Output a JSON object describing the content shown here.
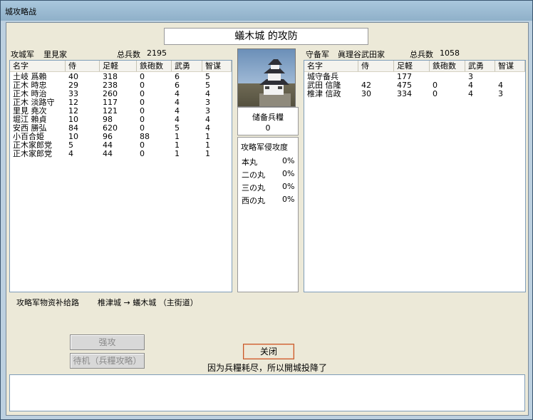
{
  "window": {
    "title": "城攻略战"
  },
  "header": {
    "title": "蟻木城 的攻防"
  },
  "attacker": {
    "label": "攻城军",
    "clan": "里見家",
    "total_label": "总兵数",
    "total": "2195",
    "columns": [
      "名字",
      "侍",
      "足軽",
      "鉄砲数",
      "武勇",
      "智谋"
    ],
    "rows": [
      {
        "name": "土岐 爲賴",
        "samurai": "40",
        "ashigaru": "318",
        "guns": "0",
        "valor": "6",
        "wit": "5"
      },
      {
        "name": "正木 時忠",
        "samurai": "29",
        "ashigaru": "238",
        "guns": "0",
        "valor": "6",
        "wit": "5"
      },
      {
        "name": "正木 時治",
        "samurai": "33",
        "ashigaru": "260",
        "guns": "0",
        "valor": "4",
        "wit": "4"
      },
      {
        "name": "正木 淡路守",
        "samurai": "12",
        "ashigaru": "117",
        "guns": "0",
        "valor": "4",
        "wit": "3"
      },
      {
        "name": "里見 堯次",
        "samurai": "12",
        "ashigaru": "121",
        "guns": "0",
        "valor": "4",
        "wit": "3"
      },
      {
        "name": "堀江 賴貞",
        "samurai": "10",
        "ashigaru": "98",
        "guns": "0",
        "valor": "4",
        "wit": "4"
      },
      {
        "name": "安西 勝弘",
        "samurai": "84",
        "ashigaru": "620",
        "guns": "0",
        "valor": "5",
        "wit": "4"
      },
      {
        "name": "小百合姫",
        "samurai": "10",
        "ashigaru": "96",
        "guns": "88",
        "valor": "1",
        "wit": "1"
      },
      {
        "name": "正木家郎党",
        "samurai": "5",
        "ashigaru": "44",
        "guns": "0",
        "valor": "1",
        "wit": "1"
      },
      {
        "name": "正木家郎党",
        "samurai": "4",
        "ashigaru": "44",
        "guns": "0",
        "valor": "1",
        "wit": "1"
      }
    ]
  },
  "defender": {
    "label": "守备军",
    "clan": "眞理谷武田家",
    "total_label": "总兵数",
    "total": "1058",
    "columns": [
      "名字",
      "侍",
      "足軽",
      "鉄砲数",
      "武勇",
      "智谋"
    ],
    "rows": [
      {
        "name": "城守备兵",
        "samurai": "",
        "ashigaru": "177",
        "guns": "",
        "valor": "3",
        "wit": ""
      },
      {
        "name": "武田 信隆",
        "samurai": "42",
        "ashigaru": "475",
        "guns": "0",
        "valor": "4",
        "wit": "4"
      },
      {
        "name": "椎津 信政",
        "samurai": "30",
        "ashigaru": "334",
        "guns": "0",
        "valor": "4",
        "wit": "3"
      }
    ]
  },
  "center": {
    "reserve_label": "储备兵糧",
    "reserve_value": "0",
    "invasion_label": "攻略军侵攻度",
    "invasion": [
      {
        "area": "本丸",
        "value": "0%"
      },
      {
        "area": "二の丸",
        "value": "0%"
      },
      {
        "area": "三の丸",
        "value": "0%"
      },
      {
        "area": "西の丸",
        "value": "0%"
      }
    ]
  },
  "supply": {
    "label": "攻略军物资补给路",
    "route": "椎津城 → 蟻木城 （主街道）"
  },
  "buttons": {
    "assault": "强攻",
    "wait": "待机（兵糧攻略）",
    "close": "关闭"
  },
  "message": "因为兵糧耗尽，所以開城投降了",
  "log_text": "",
  "icons": {
    "castle": "castle-image"
  }
}
